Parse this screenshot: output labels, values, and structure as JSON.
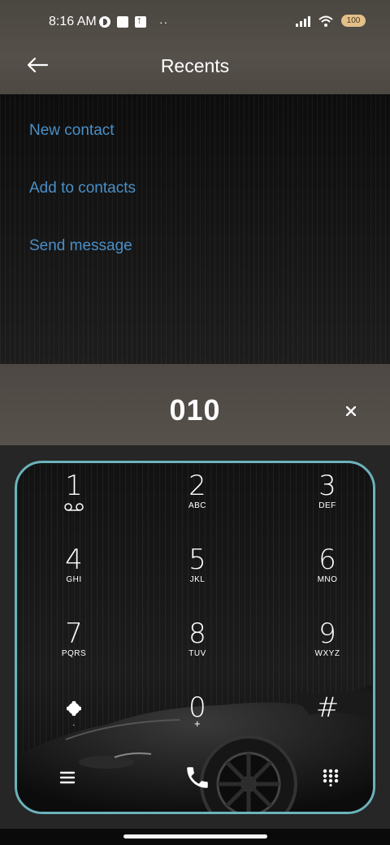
{
  "status_bar": {
    "time": "8:16 AM",
    "dots": "··",
    "battery": "100"
  },
  "header": {
    "title": "Recents",
    "back_icon": "arrow-left-icon"
  },
  "actions": [
    {
      "label": "New contact"
    },
    {
      "label": "Add to contacts"
    },
    {
      "label": "Send message"
    }
  ],
  "dialer": {
    "number": "010",
    "clear_icon": "close-icon"
  },
  "keys": [
    {
      "digit": "1",
      "letters": "voicemail-icon"
    },
    {
      "digit": "2",
      "letters": "ABC"
    },
    {
      "digit": "3",
      "letters": "DEF"
    },
    {
      "digit": "4",
      "letters": "GHI"
    },
    {
      "digit": "5",
      "letters": "JKL"
    },
    {
      "digit": "6",
      "letters": "MNO"
    },
    {
      "digit": "7",
      "letters": "PQRS"
    },
    {
      "digit": "8",
      "letters": "TUV"
    },
    {
      "digit": "9",
      "letters": "WXYZ"
    },
    {
      "digit": "*",
      "letters": "·"
    },
    {
      "digit": "0",
      "letters": "+"
    },
    {
      "digit": "#",
      "letters": ""
    }
  ],
  "colors": {
    "accent_link": "#4a8fc7",
    "keypad_border": "#6bb3bb",
    "header_bg": "#4d4843",
    "battery": "#e3c08a"
  }
}
